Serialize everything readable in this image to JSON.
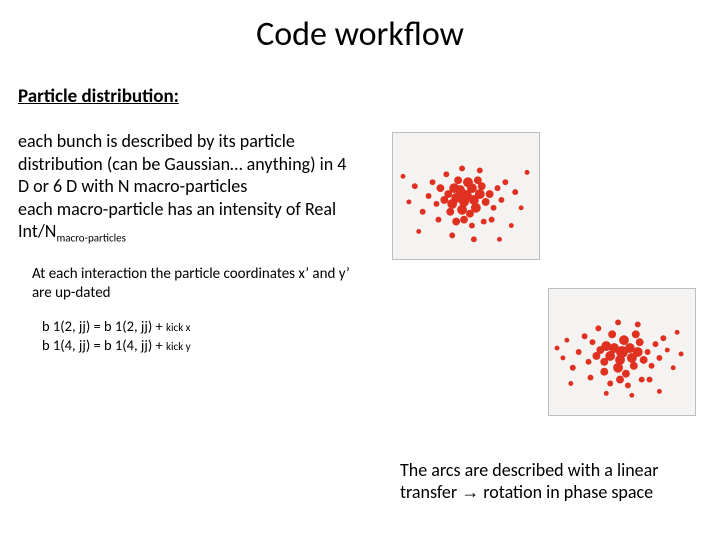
{
  "title": "Code workflow",
  "section_heading": "Particle distribution:",
  "body_html": "each bunch is described by its particle distribution (can be Gaussian… anything) in 4 D or 6 D with N macro-particles<br>each macro-particle has an intensity of Real Int/N<sub>macro-particles</sub>",
  "interaction_note": "At each interaction the particle coordinates x’ and y’ are up-dated",
  "eq_line1": "b 1(2, jj)  =  b 1(2, jj)  +  <span class=\"sm\">kick x</span>",
  "eq_line2": "b 1(4, jj)  =  b 1(4, jj)  +  <span class=\"sm\">kick y</span>",
  "arcs_text": "The arcs are described with a linear transfer <span class=\"arrow\">→</span> rotation in phase space",
  "cluster1_points": [
    [
      74,
      64,
      6
    ],
    [
      68,
      58,
      5
    ],
    [
      80,
      56,
      5
    ],
    [
      72,
      70,
      5
    ],
    [
      64,
      66,
      5
    ],
    [
      82,
      68,
      5
    ],
    [
      76,
      50,
      5
    ],
    [
      62,
      56,
      5
    ],
    [
      88,
      62,
      5
    ],
    [
      70,
      78,
      5
    ],
    [
      60,
      72,
      5
    ],
    [
      84,
      76,
      5
    ],
    [
      56,
      62,
      4
    ],
    [
      90,
      54,
      4
    ],
    [
      78,
      82,
      4
    ],
    [
      52,
      68,
      4
    ],
    [
      94,
      70,
      4
    ],
    [
      66,
      48,
      4
    ],
    [
      86,
      48,
      4
    ],
    [
      58,
      80,
      4
    ],
    [
      72,
      88,
      4
    ],
    [
      48,
      56,
      4
    ],
    [
      98,
      62,
      4
    ],
    [
      64,
      90,
      4
    ],
    [
      44,
      72,
      3
    ],
    [
      102,
      76,
      3
    ],
    [
      80,
      94,
      3
    ],
    [
      40,
      50,
      3
    ],
    [
      106,
      56,
      3
    ],
    [
      54,
      42,
      3
    ],
    [
      92,
      90,
      3
    ],
    [
      36,
      64,
      3
    ],
    [
      110,
      68,
      3
    ],
    [
      70,
      36,
      3
    ],
    [
      88,
      38,
      3
    ],
    [
      46,
      88,
      3
    ],
    [
      114,
      50,
      3
    ],
    [
      30,
      80,
      3
    ],
    [
      100,
      88,
      3
    ],
    [
      124,
      60,
      3
    ],
    [
      22,
      54,
      3
    ],
    [
      130,
      76,
      2.5
    ],
    [
      16,
      70,
      2.5
    ],
    [
      60,
      104,
      3
    ],
    [
      82,
      108,
      3
    ],
    [
      120,
      94,
      2.5
    ],
    [
      10,
      44,
      2.5
    ],
    [
      136,
      40,
      2.5
    ],
    [
      26,
      100,
      2.5
    ],
    [
      108,
      108,
      2.5
    ]
  ],
  "cluster2_points": [
    [
      74,
      64,
      6
    ],
    [
      66,
      60,
      5
    ],
    [
      82,
      60,
      5
    ],
    [
      72,
      72,
      5
    ],
    [
      62,
      68,
      5
    ],
    [
      84,
      70,
      5
    ],
    [
      76,
      52,
      5
    ],
    [
      58,
      58,
      5
    ],
    [
      90,
      64,
      5
    ],
    [
      70,
      80,
      5
    ],
    [
      56,
      74,
      4
    ],
    [
      86,
      78,
      4
    ],
    [
      52,
      62,
      4
    ],
    [
      92,
      54,
      4
    ],
    [
      78,
      86,
      4
    ],
    [
      48,
      68,
      4
    ],
    [
      96,
      72,
      4
    ],
    [
      64,
      46,
      4
    ],
    [
      88,
      46,
      4
    ],
    [
      56,
      84,
      4
    ],
    [
      72,
      92,
      4
    ],
    [
      44,
      54,
      3
    ],
    [
      100,
      64,
      3
    ],
    [
      62,
      96,
      3
    ],
    [
      40,
      74,
      3
    ],
    [
      104,
      78,
      3
    ],
    [
      80,
      98,
      3
    ],
    [
      36,
      48,
      3
    ],
    [
      108,
      56,
      3
    ],
    [
      50,
      40,
      3
    ],
    [
      94,
      92,
      3
    ],
    [
      30,
      64,
      3
    ],
    [
      112,
      70,
      3
    ],
    [
      70,
      34,
      3
    ],
    [
      90,
      36,
      3
    ],
    [
      42,
      90,
      3
    ],
    [
      116,
      50,
      3
    ],
    [
      24,
      80,
      3
    ],
    [
      102,
      92,
      3
    ],
    [
      120,
      62,
      2.5
    ],
    [
      18,
      52,
      2.5
    ],
    [
      126,
      80,
      2.5
    ],
    [
      14,
      70,
      2.5
    ],
    [
      58,
      106,
      2.5
    ],
    [
      84,
      108,
      2.5
    ],
    [
      130,
      44,
      2.5
    ],
    [
      8,
      60,
      2.5
    ],
    [
      22,
      96,
      2.5
    ],
    [
      112,
      104,
      2.5
    ],
    [
      134,
      66,
      2.5
    ]
  ],
  "dot_color": "#e03020"
}
